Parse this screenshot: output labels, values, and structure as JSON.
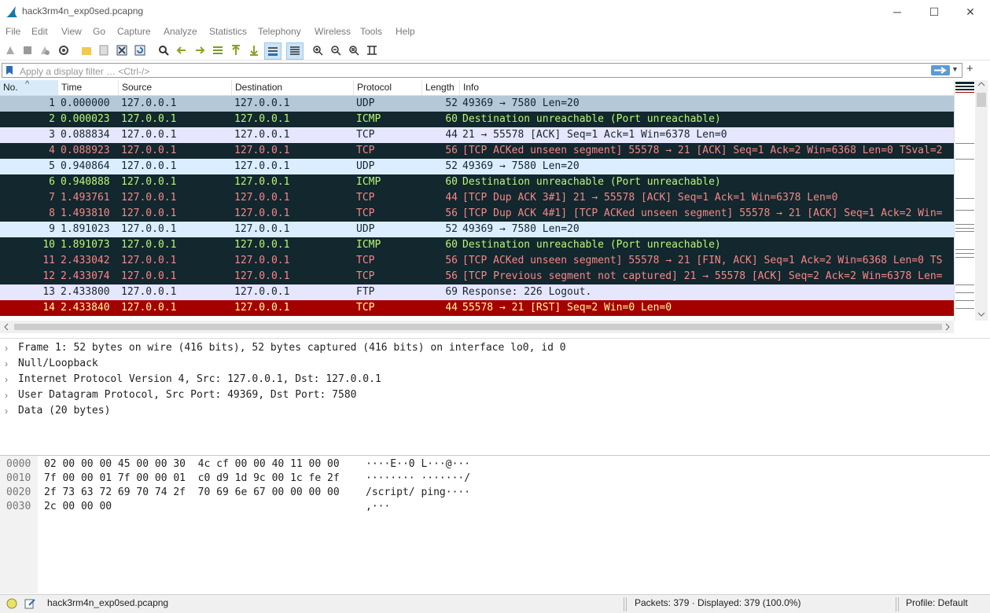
{
  "window": {
    "title": "hack3rm4n_exp0sed.pcapng",
    "minimize": "─",
    "maximize": "☐",
    "close": "✕"
  },
  "menu": [
    "File",
    "Edit",
    "View",
    "Go",
    "Capture",
    "Analyze",
    "Statistics",
    "Telephony",
    "Wireless",
    "Tools",
    "Help"
  ],
  "filter": {
    "placeholder": "Apply a display filter … <Ctrl-/>",
    "dropdown": "▼",
    "add": "+"
  },
  "packet_list": {
    "columns": [
      "No.",
      "Time",
      "Source",
      "Destination",
      "Protocol",
      "Length",
      "Info"
    ],
    "sort_indicator": "^",
    "rows": [
      {
        "no": "1",
        "time": "0.000000",
        "src": "127.0.0.1",
        "dst": "127.0.0.1",
        "proto": "UDP",
        "len": "52",
        "info": "49369 → 7580 Len=20",
        "bg": "#b4c8d8",
        "fg": "#12272e"
      },
      {
        "no": "2",
        "time": "0.000023",
        "src": "127.0.0.1",
        "dst": "127.0.0.1",
        "proto": "ICMP",
        "len": "60",
        "info": "Destination unreachable (Port unreachable)",
        "bg": "#12272e",
        "fg": "#b7f774"
      },
      {
        "no": "3",
        "time": "0.088834",
        "src": "127.0.0.1",
        "dst": "127.0.0.1",
        "proto": "TCP",
        "len": "44",
        "info": "21 → 55578 [ACK] Seq=1 Ack=1 Win=6378 Len=0",
        "bg": "#e7e6ff",
        "fg": "#12272e"
      },
      {
        "no": "4",
        "time": "0.088923",
        "src": "127.0.0.1",
        "dst": "127.0.0.1",
        "proto": "TCP",
        "len": "56",
        "info": "[TCP ACKed unseen segment] 55578 → 21 [ACK] Seq=1 Ack=2 Win=6368 Len=0 TSval=2",
        "bg": "#12272e",
        "fg": "#f78787"
      },
      {
        "no": "5",
        "time": "0.940864",
        "src": "127.0.0.1",
        "dst": "127.0.0.1",
        "proto": "UDP",
        "len": "52",
        "info": "49369 → 7580 Len=20",
        "bg": "#daeeff",
        "fg": "#12272e"
      },
      {
        "no": "6",
        "time": "0.940888",
        "src": "127.0.0.1",
        "dst": "127.0.0.1",
        "proto": "ICMP",
        "len": "60",
        "info": "Destination unreachable (Port unreachable)",
        "bg": "#12272e",
        "fg": "#b7f774"
      },
      {
        "no": "7",
        "time": "1.493761",
        "src": "127.0.0.1",
        "dst": "127.0.0.1",
        "proto": "TCP",
        "len": "44",
        "info": "[TCP Dup ACK 3#1] 21 → 55578 [ACK] Seq=1 Ack=1 Win=6378 Len=0",
        "bg": "#12272e",
        "fg": "#f78787"
      },
      {
        "no": "8",
        "time": "1.493810",
        "src": "127.0.0.1",
        "dst": "127.0.0.1",
        "proto": "TCP",
        "len": "56",
        "info": "[TCP Dup ACK 4#1] [TCP ACKed unseen segment] 55578 → 21 [ACK] Seq=1 Ack=2 Win=",
        "bg": "#12272e",
        "fg": "#f78787"
      },
      {
        "no": "9",
        "time": "1.891023",
        "src": "127.0.0.1",
        "dst": "127.0.0.1",
        "proto": "UDP",
        "len": "52",
        "info": "49369 → 7580 Len=20",
        "bg": "#daeeff",
        "fg": "#12272e"
      },
      {
        "no": "10",
        "time": "1.891073",
        "src": "127.0.0.1",
        "dst": "127.0.0.1",
        "proto": "ICMP",
        "len": "60",
        "info": "Destination unreachable (Port unreachable)",
        "bg": "#12272e",
        "fg": "#b7f774"
      },
      {
        "no": "11",
        "time": "2.433042",
        "src": "127.0.0.1",
        "dst": "127.0.0.1",
        "proto": "TCP",
        "len": "56",
        "info": "[TCP ACKed unseen segment] 55578 → 21 [FIN, ACK] Seq=1 Ack=2 Win=6368 Len=0 TS",
        "bg": "#12272e",
        "fg": "#f78787"
      },
      {
        "no": "12",
        "time": "2.433074",
        "src": "127.0.0.1",
        "dst": "127.0.0.1",
        "proto": "TCP",
        "len": "56",
        "info": "[TCP Previous segment not captured] 21 → 55578 [ACK] Seq=2 Ack=2 Win=6378 Len=",
        "bg": "#12272e",
        "fg": "#f78787"
      },
      {
        "no": "13",
        "time": "2.433800",
        "src": "127.0.0.1",
        "dst": "127.0.0.1",
        "proto": "FTP",
        "len": "69",
        "info": "Response: 226 Logout.",
        "bg": "#e7e6ff",
        "fg": "#12272e"
      },
      {
        "no": "14",
        "time": "2.433840",
        "src": "127.0.0.1",
        "dst": "127.0.0.1",
        "proto": "TCP",
        "len": "44",
        "info": "55578 → 21 [RST] Seq=2 Win=0 Len=0",
        "bg": "#a40000",
        "fg": "#fffc9c"
      }
    ]
  },
  "details": [
    "Frame 1: 52 bytes on wire (416 bits), 52 bytes captured (416 bits) on interface lo0, id 0",
    "Null/Loopback",
    "Internet Protocol Version 4, Src: 127.0.0.1, Dst: 127.0.0.1",
    "User Datagram Protocol, Src Port: 49369, Dst Port: 7580",
    "Data (20 bytes)"
  ],
  "bytes": [
    {
      "offset": "0000",
      "hex": "02 00 00 00 45 00 00 30  4c cf 00 00 40 11 00 00",
      "ascii": "····E··0 L···@···"
    },
    {
      "offset": "0010",
      "hex": "7f 00 00 01 7f 00 00 01  c0 d9 1d 9c 00 1c fe 2f",
      "ascii": "········ ·······/"
    },
    {
      "offset": "0020",
      "hex": "2f 73 63 72 69 70 74 2f  70 69 6e 67 00 00 00 00",
      "ascii": "/script/ ping····"
    },
    {
      "offset": "0030",
      "hex": "2c 00 00 00",
      "ascii": ",···"
    }
  ],
  "status": {
    "file": "hack3rm4n_exp0sed.pcapng",
    "packets": "Packets: 379 · Displayed: 379 (100.0%)",
    "profile": "Profile: Default"
  }
}
